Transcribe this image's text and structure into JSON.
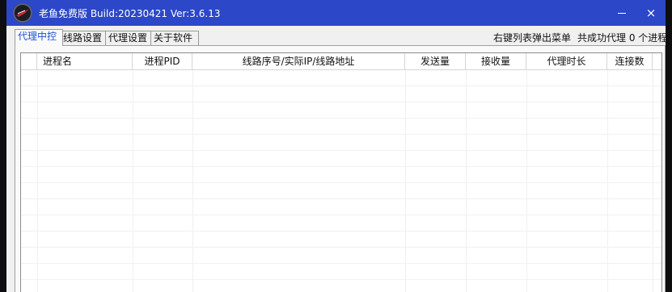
{
  "window": {
    "title": "老鱼免费版 Build:20230421 Ver:3.6.13",
    "minimize_label": "–",
    "close_label": "×",
    "logo_icon": "fish-logo-icon"
  },
  "tabs": [
    {
      "label": "代理中控",
      "active": true
    },
    {
      "label": "线路设置",
      "active": false
    },
    {
      "label": "代理设置",
      "active": false
    },
    {
      "label": "关于软件",
      "active": false
    }
  ],
  "hints": {
    "context_menu": "右键列表弹出菜单",
    "proxy_count": "共成功代理 0 个进程"
  },
  "table": {
    "columns": [
      "",
      "进程名",
      "进程PID",
      "线路序号/实际IP/线路地址",
      "发送量",
      "接收量",
      "代理时长",
      "连接数"
    ],
    "rows": []
  },
  "colors": {
    "titlebar": "#2c47c7",
    "active_tab_text": "#1f4fd8"
  }
}
